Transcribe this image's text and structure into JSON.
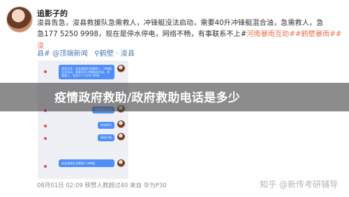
{
  "post": {
    "username": "追影子的",
    "lines": [
      "浚县告急，浚县救援队急需救人，冲锋艇没法启动，需要40升冲锋艇混合油，急需救人，急",
      "急177 5250 9998，现在是停水停电，网络不畅，有事联系不上#",
      "县#"
    ],
    "hashtag_inline": "河南暴雨互助##鹤壁暴雨##浚",
    "link_video": "@顶端新闻",
    "location": "鹤壁 · 浚县",
    "footer": "08月01日 02:09 转赞人数超过40   来自 华为P30",
    "watermark": "知乎 @新传考研辅导"
  },
  "overlay": {
    "title": "疫情政府救助/政府救助电话是多少"
  },
  "screenshot": {
    "bubble_1": "浚县告急，浚县救援队急需救人，冲锋艇没法启动，需要40升冲锋艇混合油，急需救人，急急177 5250 9998",
    "bubble_2": "冲锋艇混合油",
    "bubble_3": "停电停水",
    "bubble_4": "网络不畅",
    "bubble_5": "浚县救援队急需救人冲锋艇"
  },
  "colors": {
    "hashtag": "#eb7350",
    "link": "#507daf",
    "bubble": "#4f8ff7"
  }
}
